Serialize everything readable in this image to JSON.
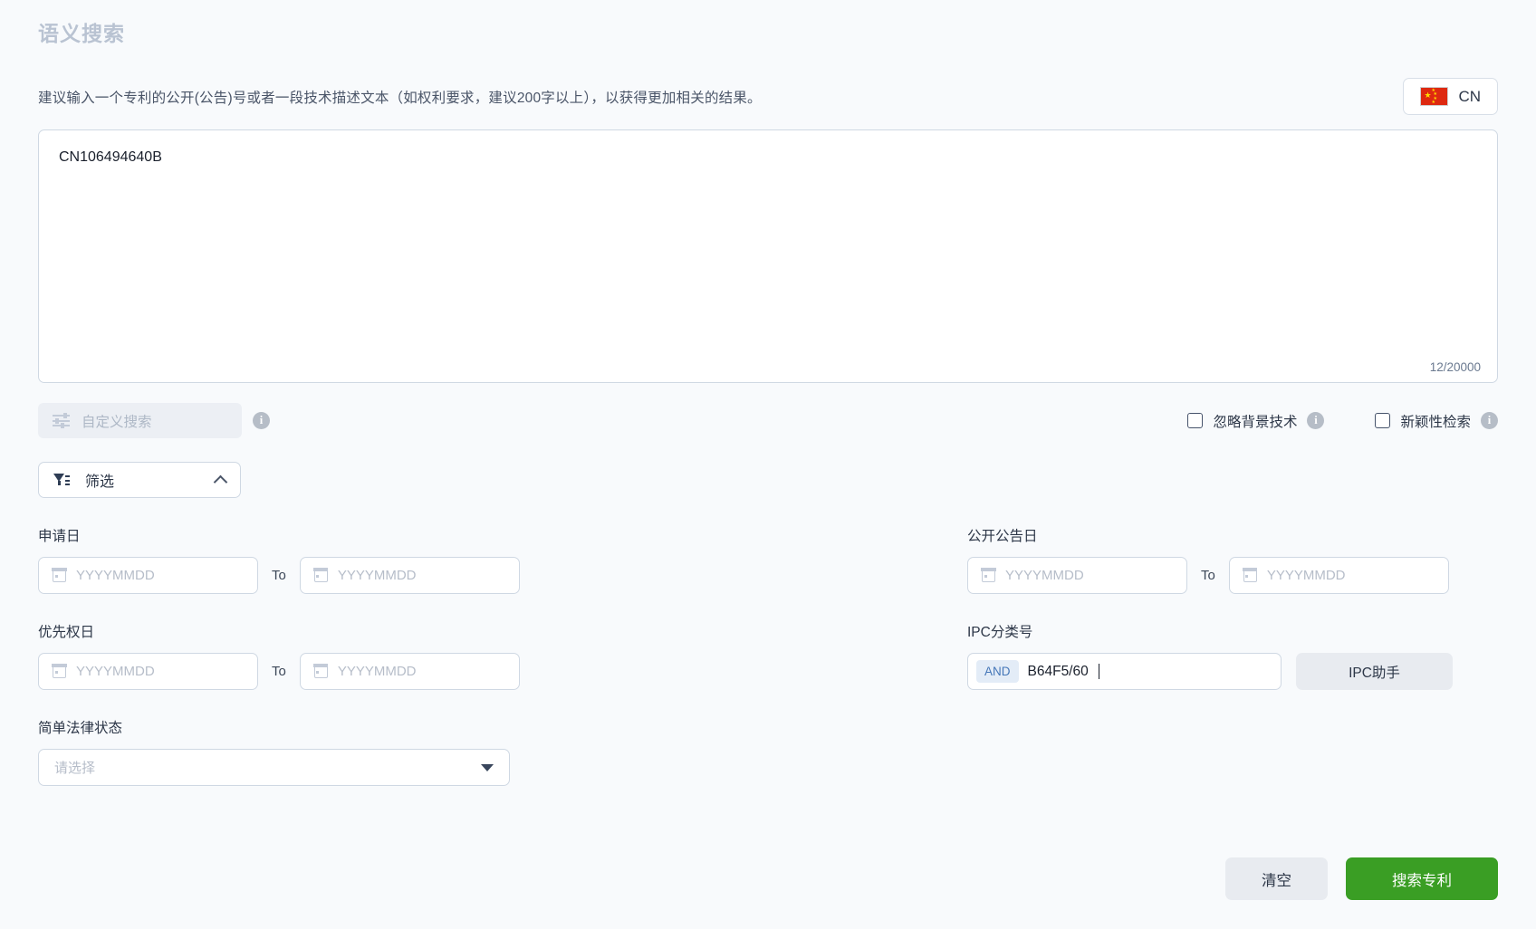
{
  "header": {
    "title": "语义搜索",
    "description": "建议输入一个专利的公开(公告)号或者一段技术描述文本（如权利要求，建议200字以上），以获得更加相关的结果。",
    "language_button": {
      "label": "CN",
      "flag_icon": "cn-flag-icon"
    }
  },
  "query": {
    "value": "CN106494640B",
    "char_count": "12/20000"
  },
  "options": {
    "custom_search": {
      "label": "自定义搜索",
      "icon": "sliders-icon",
      "info_icon": "info-icon"
    },
    "checkboxes": [
      {
        "label": "忽略背景技术",
        "checked": false,
        "info_icon": "info-icon"
      },
      {
        "label": "新颖性检索",
        "checked": false,
        "info_icon": "info-icon"
      }
    ]
  },
  "filter_toggle": {
    "label": "筛选",
    "icon": "funnel-icon",
    "chevron": "chevron-up-icon",
    "expanded": true
  },
  "filters": {
    "application_date": {
      "label": "申请日",
      "from_placeholder": "YYYYMMDD",
      "to_separator": "To",
      "to_placeholder": "YYYYMMDD",
      "from_value": "",
      "to_value": ""
    },
    "publication_date": {
      "label": "公开公告日",
      "from_placeholder": "YYYYMMDD",
      "to_separator": "To",
      "to_placeholder": "YYYYMMDD",
      "from_value": "",
      "to_value": ""
    },
    "priority_date": {
      "label": "优先权日",
      "from_placeholder": "YYYYMMDD",
      "to_separator": "To",
      "to_placeholder": "YYYYMMDD",
      "from_value": "",
      "to_value": ""
    },
    "ipc": {
      "label": "IPC分类号",
      "operator": "AND",
      "value": "B64F5/60",
      "helper_button": "IPC助手"
    },
    "legal_status": {
      "label": "简单法律状态",
      "placeholder": "请选择",
      "selected": ""
    }
  },
  "footer": {
    "clear_label": "清空",
    "search_label": "搜索专利"
  },
  "colors": {
    "background": "#f8fafc",
    "title": "#b9c3d2",
    "primary_green": "#3a9e24",
    "and_badge_bg": "#e3ecf7",
    "and_badge_text": "#4577b8",
    "flag_red": "#de2910",
    "flag_yellow": "#ffde00"
  }
}
